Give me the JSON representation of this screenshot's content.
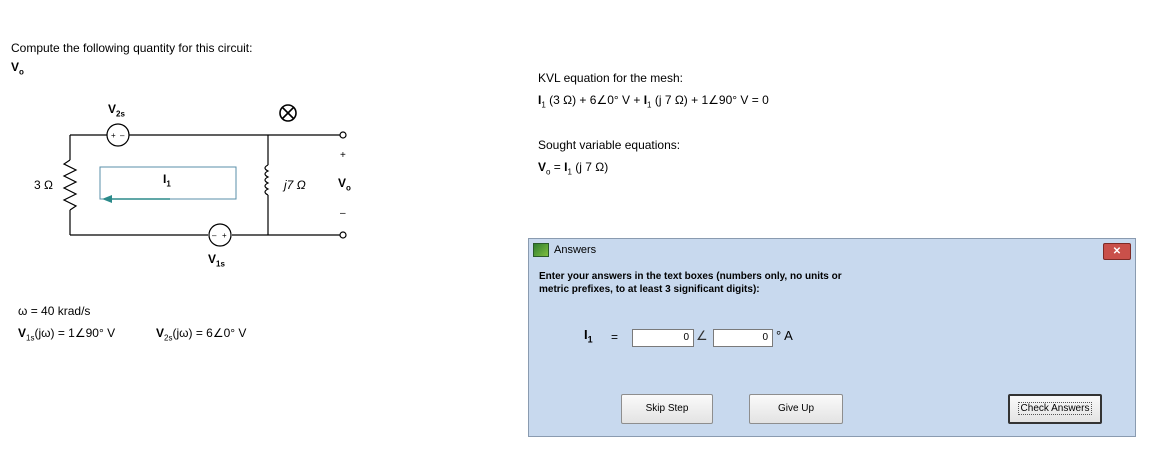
{
  "prompt": "Compute the following quantity for this circuit:",
  "target_sub": "o",
  "circuit": {
    "v2s_sub": "2s",
    "v1s_sub": "1s",
    "resistor_label": "3 Ω",
    "inductor_label": "j7 Ω",
    "current_sub": "1",
    "vo_sub": "o",
    "plus": "+",
    "minus": "–"
  },
  "params": {
    "omega": "ω = 40 krad/s",
    "v1s": "(jω) = 1∠90° V",
    "v2s": "(jω) = 6∠0° V"
  },
  "kvl": {
    "title": "KVL equation for the mesh:",
    "eq_a": " (3 Ω) + 6∠0° V + ",
    "eq_b": " (j 7 Ω) + 1∠90° V = 0"
  },
  "sought": {
    "title": "Sought variable equations:",
    "eq_a": " = ",
    "eq_b": " (j 7 Ω)"
  },
  "dialog": {
    "title": "Answers",
    "instructions": "Enter your answers in the text boxes (numbers only, no units or metric prefixes, to at least 3 significant digits):",
    "equals": "=",
    "angle_symbol": "∠",
    "magnitude_value": "0",
    "angle_value": "0",
    "unit": "° A",
    "close_label": "✕",
    "skip_label": "Skip Step",
    "give_up_label": "Give Up",
    "check_label": "Check Answers"
  }
}
